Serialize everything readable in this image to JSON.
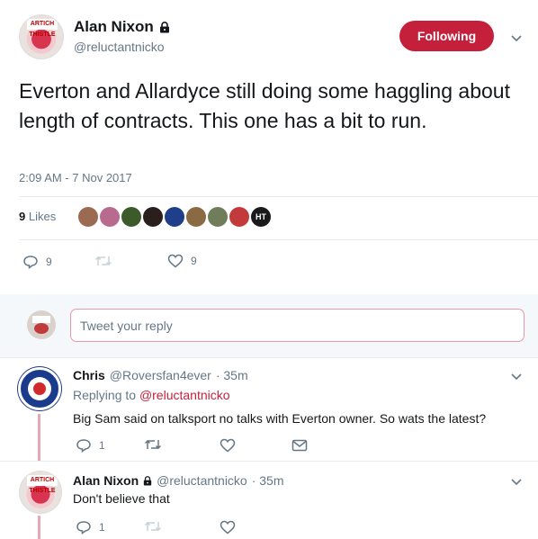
{
  "tweet": {
    "author_name": "Alan Nixon",
    "author_handle": "@reluctantnicko",
    "follow_label": "Following",
    "text": "Everton and Allardyce still doing some haggling about length of contracts. This one has a bit to run.",
    "timestamp": "2:09 AM - 7 Nov 2017",
    "likes_count": "9",
    "likes_label": "Likes",
    "reply_count": "9",
    "like_count": "9",
    "avatar_tag": "ARTICH THISTLE"
  },
  "reply_box": {
    "placeholder": "Tweet your reply"
  },
  "replies": [
    {
      "name": "Chris",
      "handle": "@Roversfan4ever",
      "time": "· 35m",
      "replying_prefix": "Replying to",
      "replying_to": "@reluctantnicko",
      "text": "Big Sam said on talksport no talks with Everton owner. So wats the latest?",
      "reply_count": "1"
    },
    {
      "name": "Alan Nixon",
      "handle": "@reluctantnicko",
      "time": "· 35m",
      "text": "Don't believe that",
      "reply_count": "1"
    }
  ],
  "colors": {
    "accent": "#c4203b",
    "muted": "#657786",
    "text": "#14171a"
  }
}
